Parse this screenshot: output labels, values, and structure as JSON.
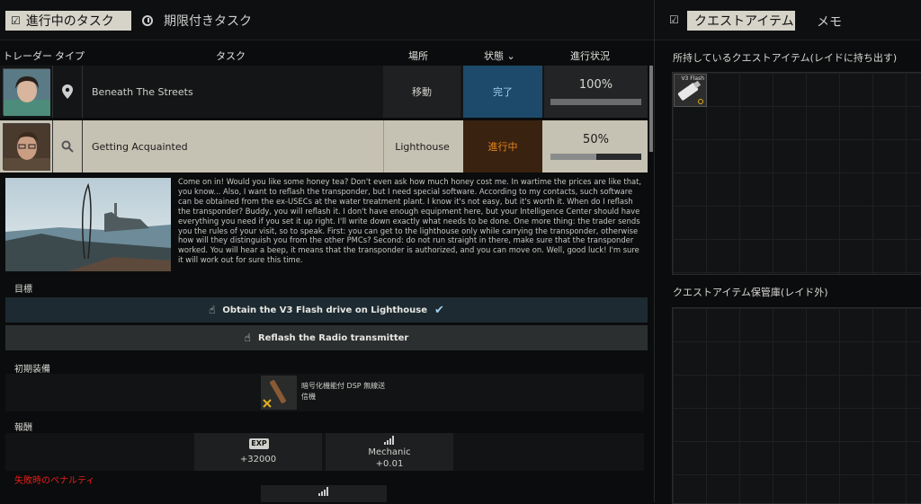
{
  "tabs": {
    "active": "進行中のタスク",
    "inactive": "期限付きタスク"
  },
  "columns": {
    "trader": "トレーダー",
    "type": "タイプ",
    "task": "タスク",
    "location": "場所",
    "status": "状態",
    "progress": "進行状況"
  },
  "tasks": [
    {
      "name": "Beneath The Streets",
      "location": "移動",
      "status": "完了",
      "progress": "100%",
      "progress_value": 1.0,
      "type_icon": "location-pin-icon"
    },
    {
      "name": "Getting Acquainted",
      "location": "Lighthouse",
      "status": "進行中",
      "progress": "50%",
      "progress_value": 0.5,
      "type_icon": "magnifier-icon"
    }
  ],
  "description": "Come on in! Would you like some honey tea? Don't even ask how much honey cost me. In wartime the prices are like that, you know... Also, I want to reflash the transponder, but I need special software. According to my contacts, such software can be obtained from the ex-USECs at the water treatment plant. I know it's not easy, but it's worth it. When do I reflash the transponder? Buddy, you will reflash it. I don't have enough equipment here, but your Intelligence Center should have everything you need if you set it up right. I'll write down exactly what needs to be done. One more thing: the trader sends you the rules of your visit, so to speak. First: you can get to the lighthouse only while carrying the transponder, otherwise how will they distinguish you from the other PMCs? Second: do not run straight in there, make sure that the transponder worked. You will hear a beep, it means that the transponder is authorized, and you can move on. Well, good luck! I'm sure it will work out for sure this time.",
  "objectives_label": "目標",
  "objectives": [
    "Obtain the V3 Flash drive on Lighthouse",
    "Reflash the Radio transmitter"
  ],
  "equipment_label": "初期装備",
  "equipment_item": "暗号化機能付 DSP 無線送信機",
  "rewards_label": "報酬",
  "rewards": {
    "exp_badge": "EXP",
    "exp_value": "+32000",
    "skill_name": "Mechanic",
    "skill_value": "+0.01"
  },
  "penalty_label": "失敗時のペナルティ",
  "right_panel": {
    "tab_active": "クエストアイテム",
    "tab_memo": "メモ",
    "owned_header": "所持しているクエストアイテム(レイドに持ち出す)",
    "stash_header": "クエストアイテム保管庫(レイド外)",
    "flash_item_label": "V3 Flash"
  },
  "colors": {
    "complete": "#1d4a6a",
    "in_progress": "#3a2210",
    "in_progress_text": "#e8861e",
    "penalty": "#e0201a"
  }
}
